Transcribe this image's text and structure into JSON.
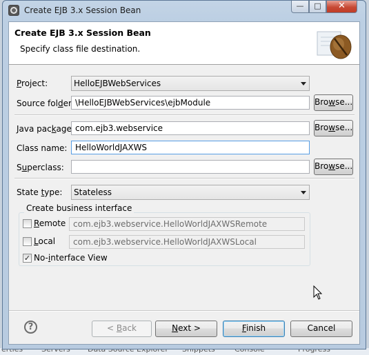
{
  "window": {
    "title": "Create EJB 3.x Session Bean",
    "min_glyph": "—",
    "max_glyph": "□",
    "close_glyph": "✕"
  },
  "banner": {
    "title": "Create EJB 3.x Session Bean",
    "description": "Specify class file destination."
  },
  "fields": {
    "project_label_pre": "",
    "project_label_u": "P",
    "project_label_post": "roject:",
    "project_value": "HelloEJBWebServices",
    "source_label_pre": "Source fol",
    "source_label_u": "d",
    "source_label_post": "er:",
    "source_value": "\\HelloEJBWebServices\\ejbModule",
    "package_label_pre": "Java pac",
    "package_label_u": "k",
    "package_label_post": "age:",
    "package_value": "com.ejb3.webservice",
    "classname_label": "Class name:",
    "classname_value": "HelloWorldJAXWS",
    "superclass_label_pre": "S",
    "superclass_label_u": "u",
    "superclass_label_post": "perclass:",
    "superclass_value": "",
    "state_label_pre": "State ",
    "state_label_u": "t",
    "state_label_post": "ype:",
    "state_value": "Stateless"
  },
  "browse": {
    "pre": "Bro",
    "u": "w",
    "post": "se..."
  },
  "business": {
    "group_title": "Create business interface",
    "remote_label_u": "R",
    "remote_label_post": "emote",
    "remote_checked": false,
    "remote_value": "com.ejb3.webservice.HelloWorldJAXWSRemote",
    "local_label_u": "L",
    "local_label_post": "ocal",
    "local_checked": false,
    "local_value": "com.ejb3.webservice.HelloWorldJAXWSLocal",
    "nointerface_pre": "No-",
    "nointerface_u": "i",
    "nointerface_post": "nterface View",
    "nointerface_checked": true,
    "check_glyph": "✓"
  },
  "footer": {
    "help_glyph": "?",
    "back_pre": "< ",
    "back_u": "B",
    "back_post": "ack",
    "next_u": "N",
    "next_post": "ext >",
    "finish_u": "F",
    "finish_post": "inish",
    "cancel": "Cancel"
  },
  "background": {
    "tab1": "erties",
    "tab2": "Servers",
    "tab3": "Data Source Explorer",
    "tab4": "Snippets",
    "tab5": "Console",
    "tab6": "Progress"
  },
  "colors": {
    "accent": "#3c7fb1",
    "close": "#c74a35"
  },
  "icons": [
    "app-icon",
    "coffee-bean-icon",
    "dropdown-arrow-icon",
    "help-icon",
    "checkbox-checked-icon",
    "mouse-cursor-icon"
  ]
}
